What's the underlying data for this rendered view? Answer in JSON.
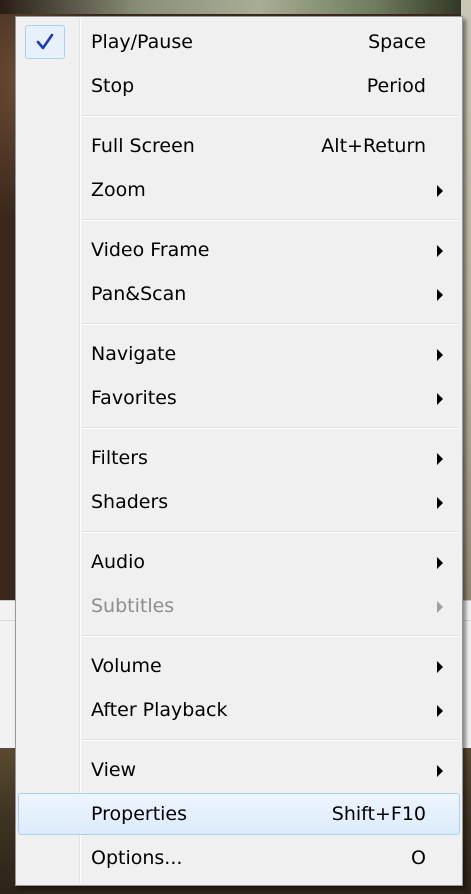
{
  "menu": {
    "groups": [
      [
        {
          "label": "Play/Pause",
          "shortcut": "Space",
          "checked": true
        },
        {
          "label": "Stop",
          "shortcut": "Period"
        }
      ],
      [
        {
          "label": "Full Screen",
          "shortcut": "Alt+Return"
        },
        {
          "label": "Zoom",
          "submenu": true
        }
      ],
      [
        {
          "label": "Video Frame",
          "submenu": true
        },
        {
          "label": "Pan&Scan",
          "submenu": true
        }
      ],
      [
        {
          "label": "Navigate",
          "submenu": true
        },
        {
          "label": "Favorites",
          "submenu": true
        }
      ],
      [
        {
          "label": "Filters",
          "submenu": true
        },
        {
          "label": "Shaders",
          "submenu": true
        }
      ],
      [
        {
          "label": "Audio",
          "submenu": true
        },
        {
          "label": "Subtitles",
          "submenu": true,
          "disabled": true
        }
      ],
      [
        {
          "label": "Volume",
          "submenu": true
        },
        {
          "label": "After Playback",
          "submenu": true
        }
      ],
      [
        {
          "label": "View",
          "submenu": true
        },
        {
          "label": "Properties",
          "shortcut": "Shift+F10",
          "highlighted": true
        },
        {
          "label": "Options...",
          "shortcut": "O"
        }
      ]
    ]
  },
  "icons": {
    "check": "check-icon",
    "submenu": "chevron-right-icon"
  },
  "colors": {
    "menu_bg": "#f0f0f0",
    "highlight_border": "#a8d0f0",
    "check_color": "#1a3cb0",
    "disabled_text": "#8d8d8d"
  }
}
